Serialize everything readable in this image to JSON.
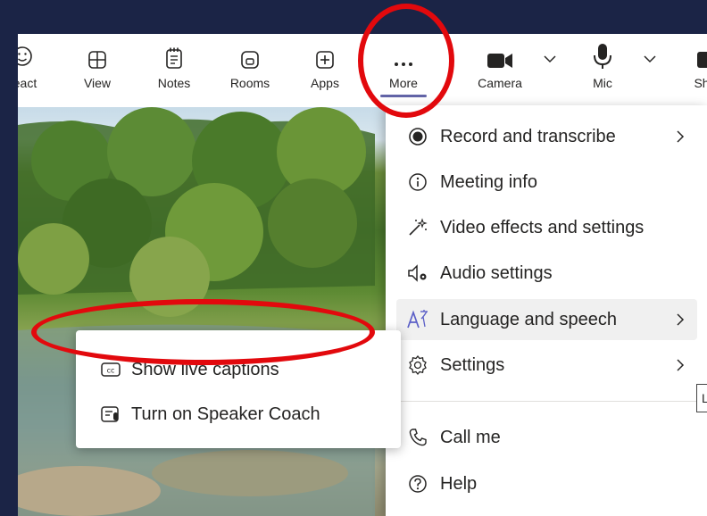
{
  "toolbar": {
    "items": [
      {
        "label": "eact",
        "icon": "smiley-icon"
      },
      {
        "label": "View",
        "icon": "grid-icon"
      },
      {
        "label": "Notes",
        "icon": "notes-icon"
      },
      {
        "label": "Rooms",
        "icon": "rooms-icon"
      },
      {
        "label": "Apps",
        "icon": "add-square-icon"
      },
      {
        "label": "More",
        "icon": "more-dots-icon",
        "selected": true
      },
      {
        "label": "Camera",
        "icon": "video-camera-icon"
      },
      {
        "label": "Mic",
        "icon": "microphone-icon"
      },
      {
        "label": "Sh",
        "icon": "share-icon"
      }
    ],
    "accent": "#6264a7"
  },
  "more_menu": {
    "items": [
      {
        "label": "Record and transcribe",
        "icon": "record-icon",
        "submenu": true
      },
      {
        "label": "Meeting info",
        "icon": "info-icon",
        "submenu": false
      },
      {
        "label": "Video effects and settings",
        "icon": "magic-wand-icon",
        "submenu": false
      },
      {
        "label": "Audio settings",
        "icon": "speaker-settings-icon",
        "submenu": false
      },
      {
        "label": "Language and speech",
        "icon": "language-icon",
        "submenu": true,
        "highlighted": true
      },
      {
        "label": "Settings",
        "icon": "gear-icon",
        "submenu": true
      },
      {
        "label": "Call me",
        "icon": "phone-icon",
        "submenu": false
      },
      {
        "label": "Help",
        "icon": "help-icon",
        "submenu": false
      }
    ]
  },
  "language_submenu": {
    "items": [
      {
        "label": "Show live captions",
        "icon": "closed-captions-icon"
      },
      {
        "label": "Turn on Speaker Coach",
        "icon": "speaker-coach-icon"
      }
    ]
  },
  "tooltip": {
    "text": "La"
  },
  "annotation": {
    "color": "#e2090d"
  }
}
